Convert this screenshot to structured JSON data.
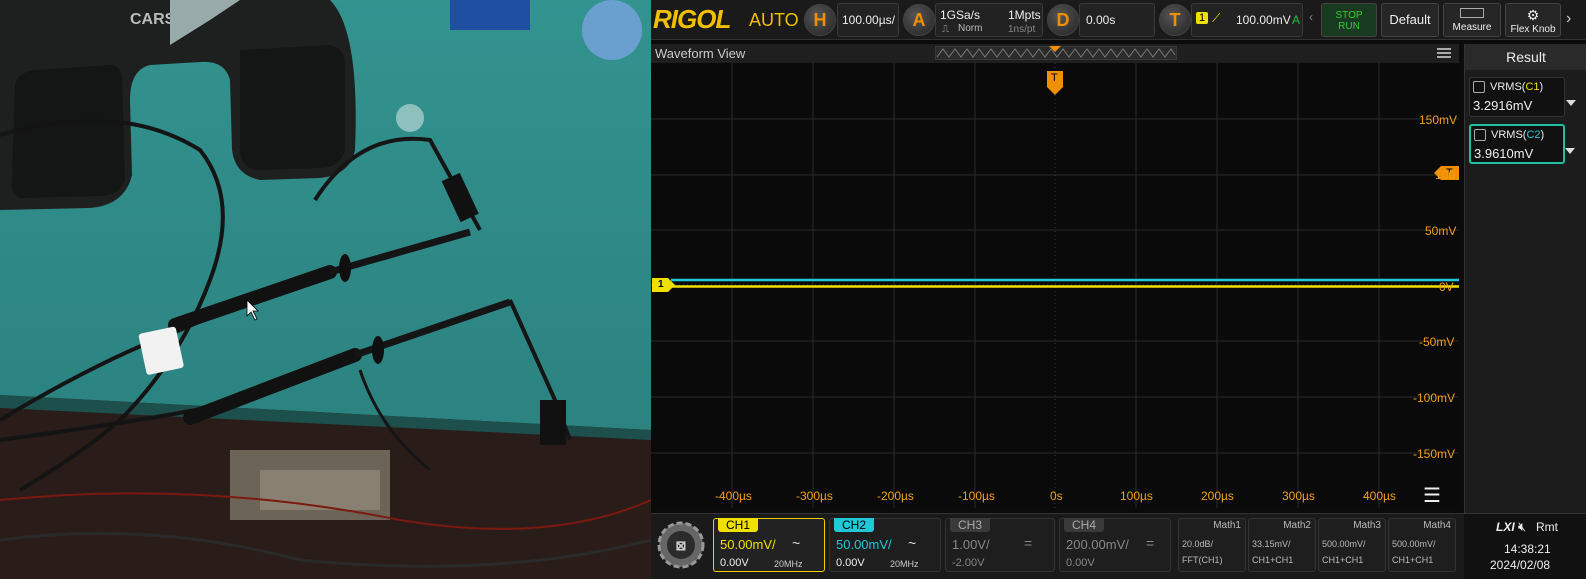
{
  "photo": {
    "label_text": "CARSO"
  },
  "topbar": {
    "logo": "RIGOL",
    "mode": "AUTO",
    "h_key": "H",
    "timebase": "100.00µs/",
    "a_key": "A",
    "sample_rate": "1GSa/s",
    "acq_mode": "Norm",
    "memory_depth": "1Mpts",
    "time_per_pt": "1ns/pt",
    "d_key": "D",
    "delay": "0.00s",
    "t_key": "T",
    "trigger_source": "1",
    "trigger_level": "100.00mV",
    "trigger_flag": "A",
    "stop_label": "STOP",
    "run_label": "RUN",
    "default_label": "Default",
    "measure_label": "Measure",
    "flexknob_label": "Flex Knob"
  },
  "waveform": {
    "title": "Waveform View",
    "trigger_marker": "T",
    "channel_marker": "1",
    "level_marker": "T",
    "v_labels": [
      "150mV",
      "100",
      "50mV",
      "0V",
      "-50mV",
      "-100mV",
      "-150mV"
    ],
    "t_labels": [
      "-400µs",
      "-300µs",
      "-200µs",
      "-100µs",
      "0s",
      "100µs",
      "200µs",
      "300µs",
      "400µs"
    ],
    "colors": {
      "ch1": "#f0e000",
      "ch2": "#20c8d8",
      "axis": "#f0a020"
    }
  },
  "result": {
    "title": "Result",
    "items": [
      {
        "name_pre": "VRMS(",
        "ch": "C1",
        "name_post": ")",
        "value": "3.2916mV"
      },
      {
        "name_pre": "VRMS(",
        "ch": "C2",
        "name_post": ")",
        "value": "3.9610mV"
      }
    ]
  },
  "channels": [
    {
      "label": "CH1",
      "scale": "50.00mV/",
      "offset": "0.00V",
      "bw": "20MHz",
      "coupling": "~"
    },
    {
      "label": "CH2",
      "scale": "50.00mV/",
      "offset": "0.00V",
      "bw": "20MHz",
      "coupling": "~"
    },
    {
      "label": "CH3",
      "scale": "1.00V/",
      "offset": "-2.00V",
      "bw": "",
      "coupling": "="
    },
    {
      "label": "CH4",
      "scale": "200.00mV/",
      "offset": "0.00V",
      "bw": "",
      "coupling": "="
    }
  ],
  "maths": [
    {
      "label": "Math1",
      "l1": "20.0dB/",
      "l2": "FFT(CH1)"
    },
    {
      "label": "Math2",
      "l1": "33.15mV/",
      "l2": "CH1+CH1"
    },
    {
      "label": "Math3",
      "l1": "500.00mV/",
      "l2": "CH1+CH1"
    },
    {
      "label": "Math4",
      "l1": "500.00mV/",
      "l2": "CH1+CH1"
    }
  ],
  "status": {
    "lxi": "LXI",
    "rmt": "Rmt",
    "time": "14:38:21",
    "date": "2024/02/08"
  }
}
